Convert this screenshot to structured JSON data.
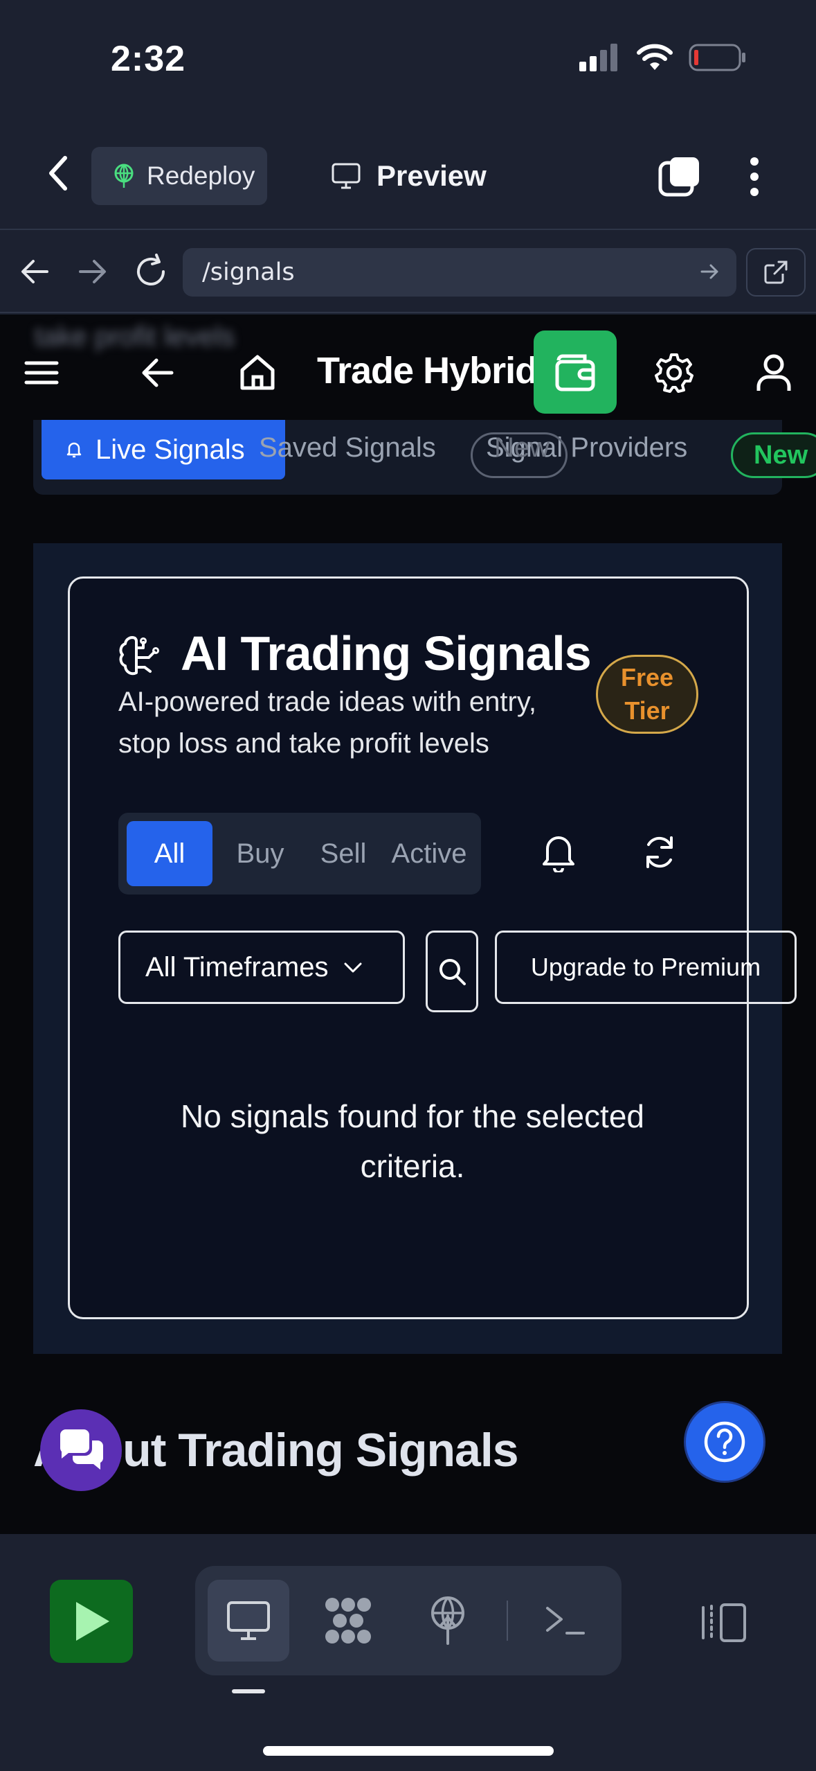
{
  "status_bar": {
    "time": "2:32"
  },
  "header": {
    "redeploy_label": "Redeploy",
    "preview_label": "Preview"
  },
  "url_bar": {
    "url": "/signals"
  },
  "site_nav": {
    "blurred_text": "take profit levels",
    "brand": "Trade Hybrid"
  },
  "tabs": [
    {
      "label": "Live Signals"
    },
    {
      "label": "Saved Signals"
    },
    {
      "label": "Signal Providers"
    },
    {
      "label": "New"
    },
    {
      "label": "New"
    }
  ],
  "card": {
    "title": "AI Trading Signals",
    "subtitle": "AI-powered trade ideas with entry, stop loss and take profit levels",
    "badge": "Free Tier",
    "filters": [
      "All",
      "Buy",
      "Sell",
      "Active"
    ],
    "active_filter": "All",
    "timeframe": "All Timeframes",
    "upgrade_label": "Upgrade to Premium",
    "empty_message": "No signals found for the selected criteria."
  },
  "about": {
    "title": "About Trading Signals"
  },
  "colors": {
    "accent": "#2563eb",
    "success": "#22b35e",
    "badge": "#e8912d",
    "chat": "#5b2fb4"
  }
}
